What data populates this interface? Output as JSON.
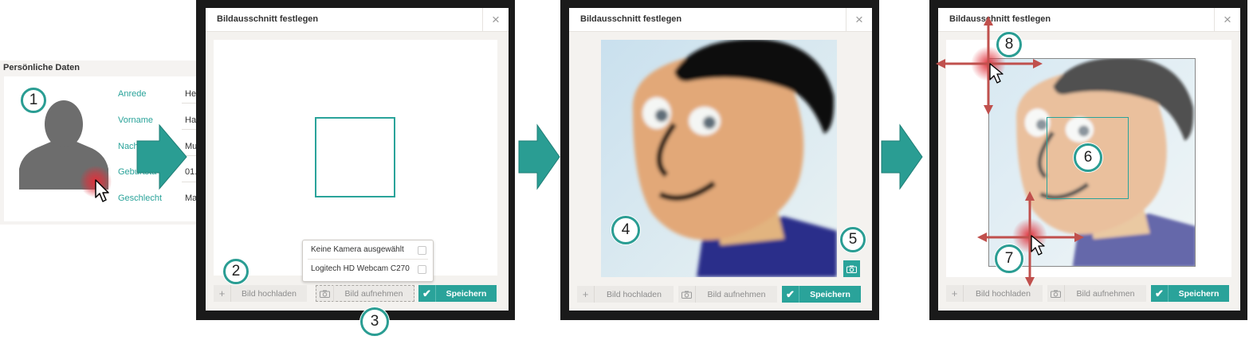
{
  "personal": {
    "title": "Persönliche Daten",
    "fields": [
      {
        "label": "Anrede",
        "value": "He"
      },
      {
        "label": "Vorname",
        "value": "Ha"
      },
      {
        "label": "Nach",
        "value": "Mu"
      },
      {
        "label": "Geburtsta",
        "value": "01."
      },
      {
        "label": "Geschlecht",
        "value": "Ma"
      }
    ]
  },
  "dialog": {
    "title": "Bildausschnitt festlegen",
    "close": "×",
    "upload_label": "Bild hochladen",
    "capture_label": "Bild aufnehmen",
    "save_label": "Speichern",
    "plus": "+",
    "check": "✔"
  },
  "camera_menu": [
    "Keine Kamera ausgewählt",
    "Logitech HD Webcam C270"
  ],
  "steps": [
    "1",
    "2",
    "3",
    "4",
    "5",
    "6",
    "7",
    "8"
  ],
  "colors": {
    "accent": "#2aa39a",
    "highlight": "#e0303a",
    "arrow": "#2a9d93",
    "drag_arrow": "#c0504d"
  }
}
